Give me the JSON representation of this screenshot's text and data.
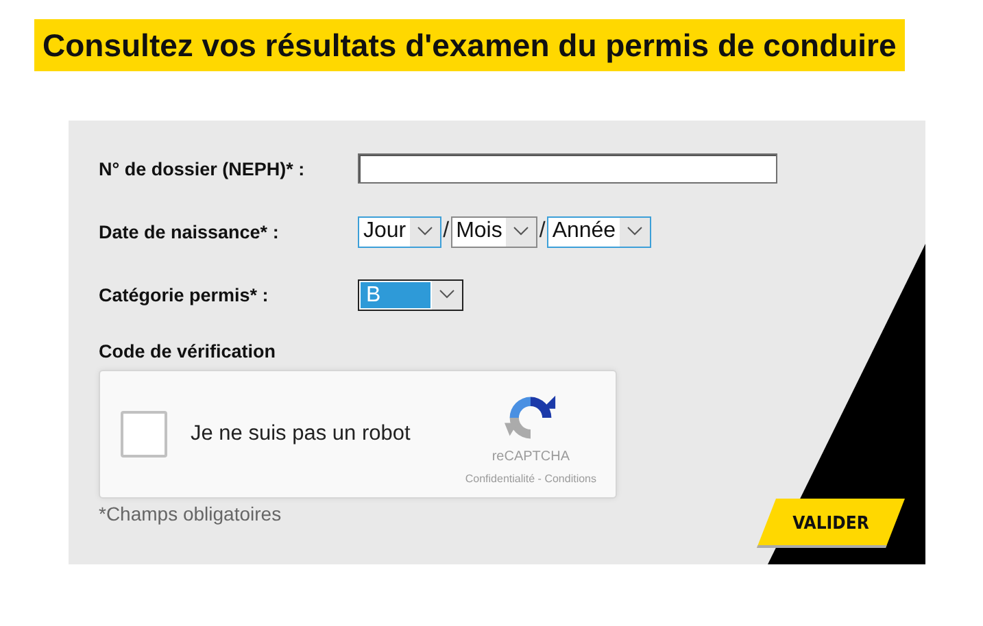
{
  "title": "Consultez vos résultats d'examen du permis de conduire",
  "form": {
    "fields": [
      {
        "kind": "text",
        "label": "N° de dossier (NEPH)* :"
      },
      {
        "kind": "date",
        "label": "Date de naissance* :",
        "separator": "/",
        "selects": [
          {
            "value": "Jour",
            "focused": true
          },
          {
            "value": "Mois",
            "focused": false
          },
          {
            "value": "Année",
            "focused": true
          }
        ]
      },
      {
        "kind": "select",
        "label": "Catégorie permis* :",
        "value": "B",
        "selected": true
      }
    ],
    "captcha": {
      "heading": "Code de vérification",
      "label": "Je ne suis pas un robot",
      "checked": false,
      "brand": "reCAPTCHA",
      "links": [
        "Confidentialité",
        "Conditions"
      ],
      "link_separator": "-"
    },
    "required_note": "*Champs obligatoires",
    "submit": "VALIDER"
  }
}
